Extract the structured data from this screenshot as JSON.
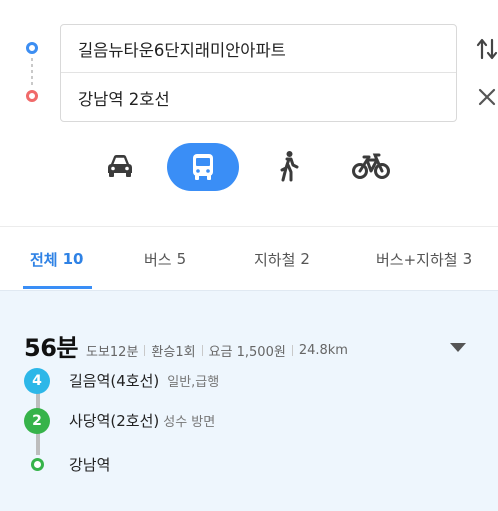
{
  "search": {
    "origin_value": "길음뉴타운6단지래미안아파트",
    "destination_value": "강남역 2호선",
    "swap_icon": "swap-vertical-icon",
    "clear_icon": "close-icon"
  },
  "modes": [
    {
      "name": "car",
      "icon": "car-icon",
      "active": false
    },
    {
      "name": "bus",
      "icon": "bus-icon",
      "active": true
    },
    {
      "name": "walk",
      "icon": "walk-icon",
      "active": false
    },
    {
      "name": "bike",
      "icon": "bicycle-icon",
      "active": false
    }
  ],
  "tabs": [
    {
      "label": "전체",
      "count": "10",
      "active": true
    },
    {
      "label": "버스",
      "count": "5",
      "active": false
    },
    {
      "label": "지하철",
      "count": "2",
      "active": false
    },
    {
      "label": "버스+지하철",
      "count": "3",
      "active": false
    }
  ],
  "route": {
    "duration": "56분",
    "walk": "도보12분",
    "transfers": "환승1회",
    "fare": "요금 1,500원",
    "distance": "24.8km",
    "stops": [
      {
        "badge": "4",
        "name": "길음역(4호선)",
        "detail": "일반,급행",
        "color": "#2db7e8"
      },
      {
        "badge": "2",
        "name": "사당역(2호선)",
        "detail": "성수 방면",
        "color": "#36b34a"
      },
      {
        "badge": "",
        "name": "강남역",
        "detail": "",
        "color": "#36b34a"
      }
    ]
  },
  "colors": {
    "accent": "#3a8ef6",
    "origin_marker": "#3d8ef2",
    "destination_marker": "#f06a6a",
    "results_background": "#eef6fd"
  }
}
